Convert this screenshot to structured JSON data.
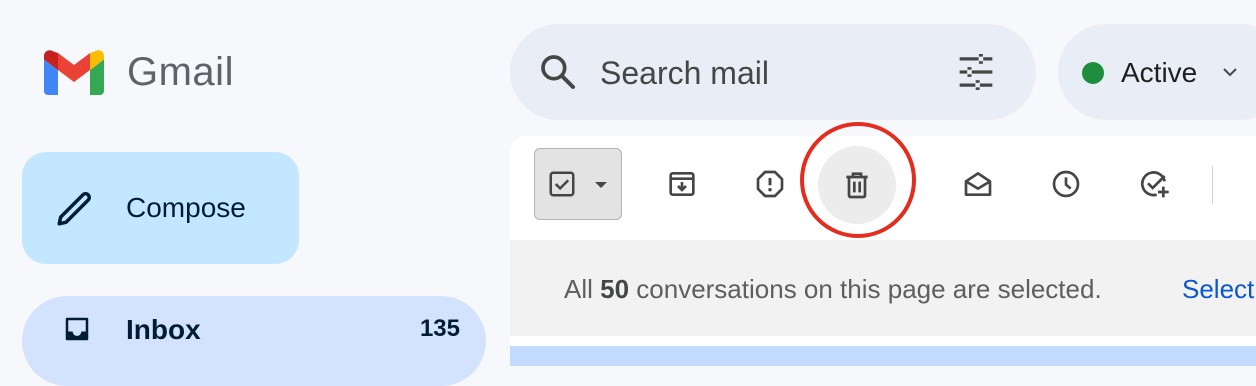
{
  "app": {
    "name": "Gmail"
  },
  "colors": {
    "accent": "#c2e7ff",
    "active_dot": "#1e8e3e",
    "annotation": "#e22d1f",
    "link": "#0b57d0"
  },
  "sidebar": {
    "compose_label": "Compose",
    "items": [
      {
        "label": "Inbox",
        "count": "135",
        "icon": "inbox-icon"
      }
    ]
  },
  "search": {
    "placeholder": "Search mail",
    "value": ""
  },
  "status": {
    "label": "Active"
  },
  "toolbar": {
    "buttons": [
      "select-all-checkbox-icon",
      "archive-icon",
      "report-spam-icon",
      "delete-icon",
      "mark-as-read-icon",
      "snooze-icon",
      "add-to-tasks-icon"
    ]
  },
  "selection_banner": {
    "prefix": "All ",
    "count": "50",
    "suffix": " conversations on this page are selected.",
    "link": "Select"
  }
}
